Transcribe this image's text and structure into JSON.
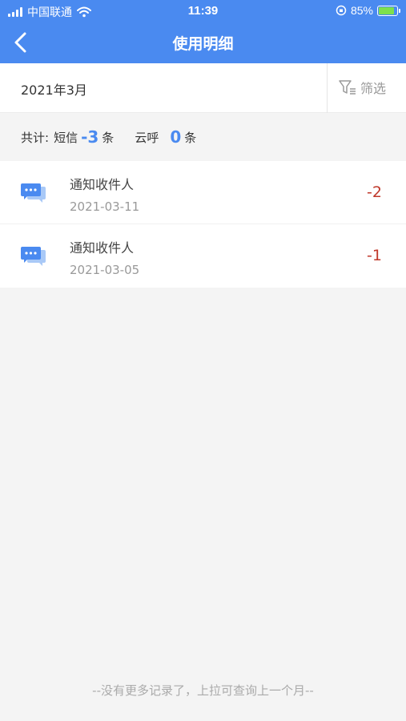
{
  "status_bar": {
    "carrier": "中国联通",
    "time": "11:39",
    "battery_percent": "85%",
    "battery_level": 0.85
  },
  "nav": {
    "title": "使用明细"
  },
  "filter": {
    "month": "2021年3月",
    "filter_label": "筛选"
  },
  "summary": {
    "prefix": "共计:",
    "sms_label": "短信",
    "sms_count": "-3",
    "sms_unit": "条",
    "call_label": "云呼",
    "call_count": "0",
    "call_unit": "条"
  },
  "records": [
    {
      "name": "通知收件人",
      "date": "2021-03-11",
      "amount": "-2",
      "icon": "sms-icon"
    },
    {
      "name": "通知收件人",
      "date": "2021-03-05",
      "amount": "-1",
      "icon": "sms-icon"
    }
  ],
  "footer": {
    "note": "--没有更多记录了，上拉可查询上一个月--"
  },
  "colors": {
    "primary": "#4a8af0",
    "negative": "#c0392b"
  }
}
